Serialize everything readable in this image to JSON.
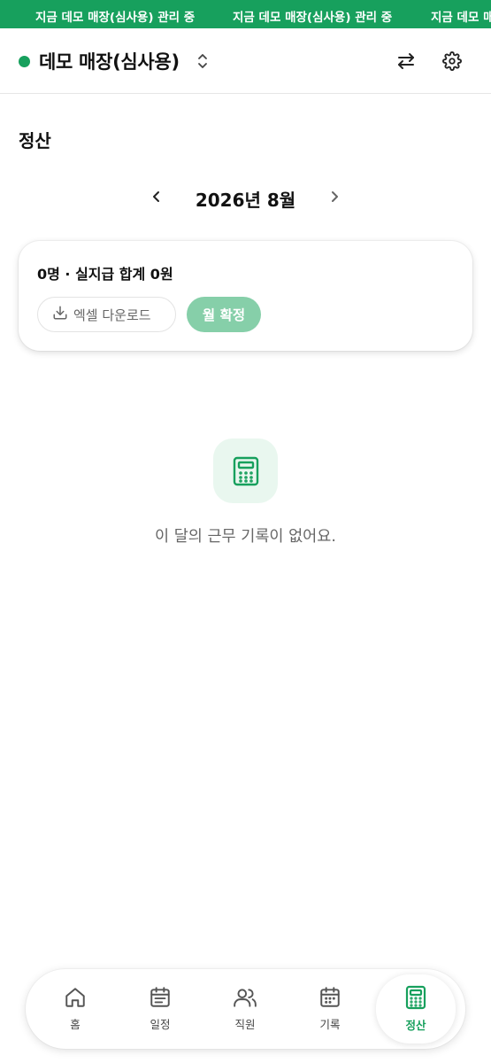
{
  "banner": {
    "text": "지금 데모 매장(심사용) 관리 중",
    "color": "#17a05d"
  },
  "header": {
    "store_name": "데모 매장(심사용)",
    "icons": [
      "status-dot",
      "chevron-updown-icon",
      "swap-icon",
      "gear-icon"
    ]
  },
  "page": {
    "title": "정산"
  },
  "month_nav": {
    "label": "2026년 8월",
    "prev_icon": "chevron-left-icon",
    "next_icon": "chevron-right-icon"
  },
  "summary_card": {
    "summary": "0명 · 실지급 합계 0원",
    "excel_label": "엑셀 다운로드",
    "confirm_label": "월 확정"
  },
  "empty_state": {
    "icon": "calculator-icon",
    "message": "이 달의 근무 기록이 없어요."
  },
  "bottom_nav": {
    "items": [
      {
        "label": "홈",
        "icon": "home-icon"
      },
      {
        "label": "일정",
        "icon": "calendar-icon"
      },
      {
        "label": "직원",
        "icon": "users-icon"
      },
      {
        "label": "기록",
        "icon": "calendar-grid-icon"
      },
      {
        "label": "정산",
        "icon": "calculator-icon",
        "active": true
      }
    ]
  },
  "colors": {
    "accent": "#17a05d",
    "accent_light": "#86cfa9",
    "accent_bg": "#e9f7ef"
  }
}
